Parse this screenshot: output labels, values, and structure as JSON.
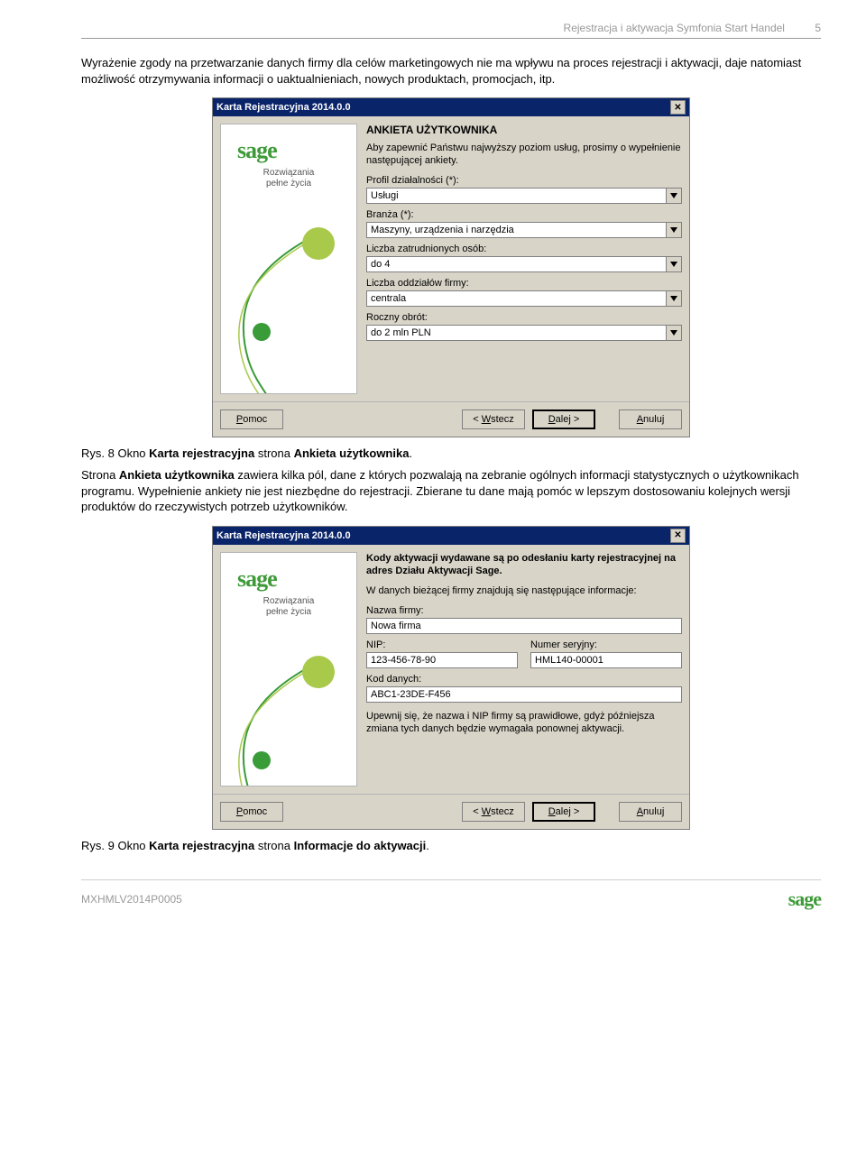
{
  "header": {
    "title": "Rejestracja i aktywacja Symfonia Start Handel",
    "page": "5"
  },
  "para1": "Wyrażenie zgody na przetwarzanie danych firmy dla celów marketingowych nie ma wpływu na proces rejestracji i aktywacji, daje natomiast możliwość otrzymywania informacji o uaktualnieniach, nowych produktach, promocjach, itp.",
  "win1": {
    "title": "Karta Rejestracyjna 2014.0.0",
    "slogan1": "Rozwiązania",
    "slogan2": "pełne życia",
    "heading": "ANKIETA UŻYTKOWNIKA",
    "intro": "Aby zapewnić Państwu najwyższy poziom usług, prosimy o wypełnienie następującej ankiety.",
    "fields": {
      "profil_label": "Profil działalności (*):",
      "profil_value": "Usługi",
      "branza_label": "Branża (*):",
      "branza_value": "Maszyny, urządzenia i narzędzia",
      "liczba_zatr_label": "Liczba zatrudnionych osób:",
      "liczba_zatr_value": "do 4",
      "liczba_odd_label": "Liczba oddziałów firmy:",
      "liczba_odd_value": "centrala",
      "obrot_label": "Roczny obrót:",
      "obrot_value": "do 2 mln PLN"
    },
    "buttons": {
      "pomoc": "Pomoc",
      "wstecz": "< Wstecz",
      "dalej": "Dalej >",
      "anuluj": "Anuluj"
    }
  },
  "caption1_a": "Rys. 8 Okno ",
  "caption1_b": "Karta rejestracyjna",
  "caption1_c": " strona ",
  "caption1_d": "Ankieta użytkownika",
  "caption1_e": ".",
  "para2a": "Strona ",
  "para2b": "Ankieta użytkownika",
  "para2c": " zawiera kilka pól, dane z których pozwalają na zebranie ogólnych informacji statystycznych o użytkownikach programu. Wypełnienie ankiety nie jest niezbędne do rejestracji. Zbierane tu dane mają pomóc w lepszym dostosowaniu kolejnych wersji produktów do rzeczywistych potrzeb użytkowników.",
  "win2": {
    "title": "Karta Rejestracyjna 2014.0.0",
    "slogan1": "Rozwiązania",
    "slogan2": "pełne życia",
    "heading": "Kody aktywacji wydawane są po odesłaniu karty rejestracyjnej na adres Działu Aktywacji Sage.",
    "intro": "W danych bieżącej firmy znajdują się następujące informacje:",
    "nazwa_label": "Nazwa firmy:",
    "nazwa_value": "Nowa firma",
    "nip_label": "NIP:",
    "nip_value": "123-456-78-90",
    "numer_label": "Numer seryjny:",
    "numer_value": "HML140-00001",
    "kod_label": "Kod danych:",
    "kod_value": "ABC1-23DE-F456",
    "note": "Upewnij się, że nazwa i NIP firmy są prawidłowe, gdyż późniejsza zmiana tych danych będzie wymagała ponownej aktywacji.",
    "buttons": {
      "pomoc": "Pomoc",
      "wstecz": "< Wstecz",
      "dalej": "Dalej >",
      "anuluj": "Anuluj"
    }
  },
  "caption2_a": "Rys. 9 Okno ",
  "caption2_b": "Karta rejestracyjna",
  "caption2_c": " strona ",
  "caption2_d": "Informacje do aktywacji",
  "caption2_e": ".",
  "footer": {
    "code": "MXHMLV2014P0005",
    "logo": "sage"
  }
}
